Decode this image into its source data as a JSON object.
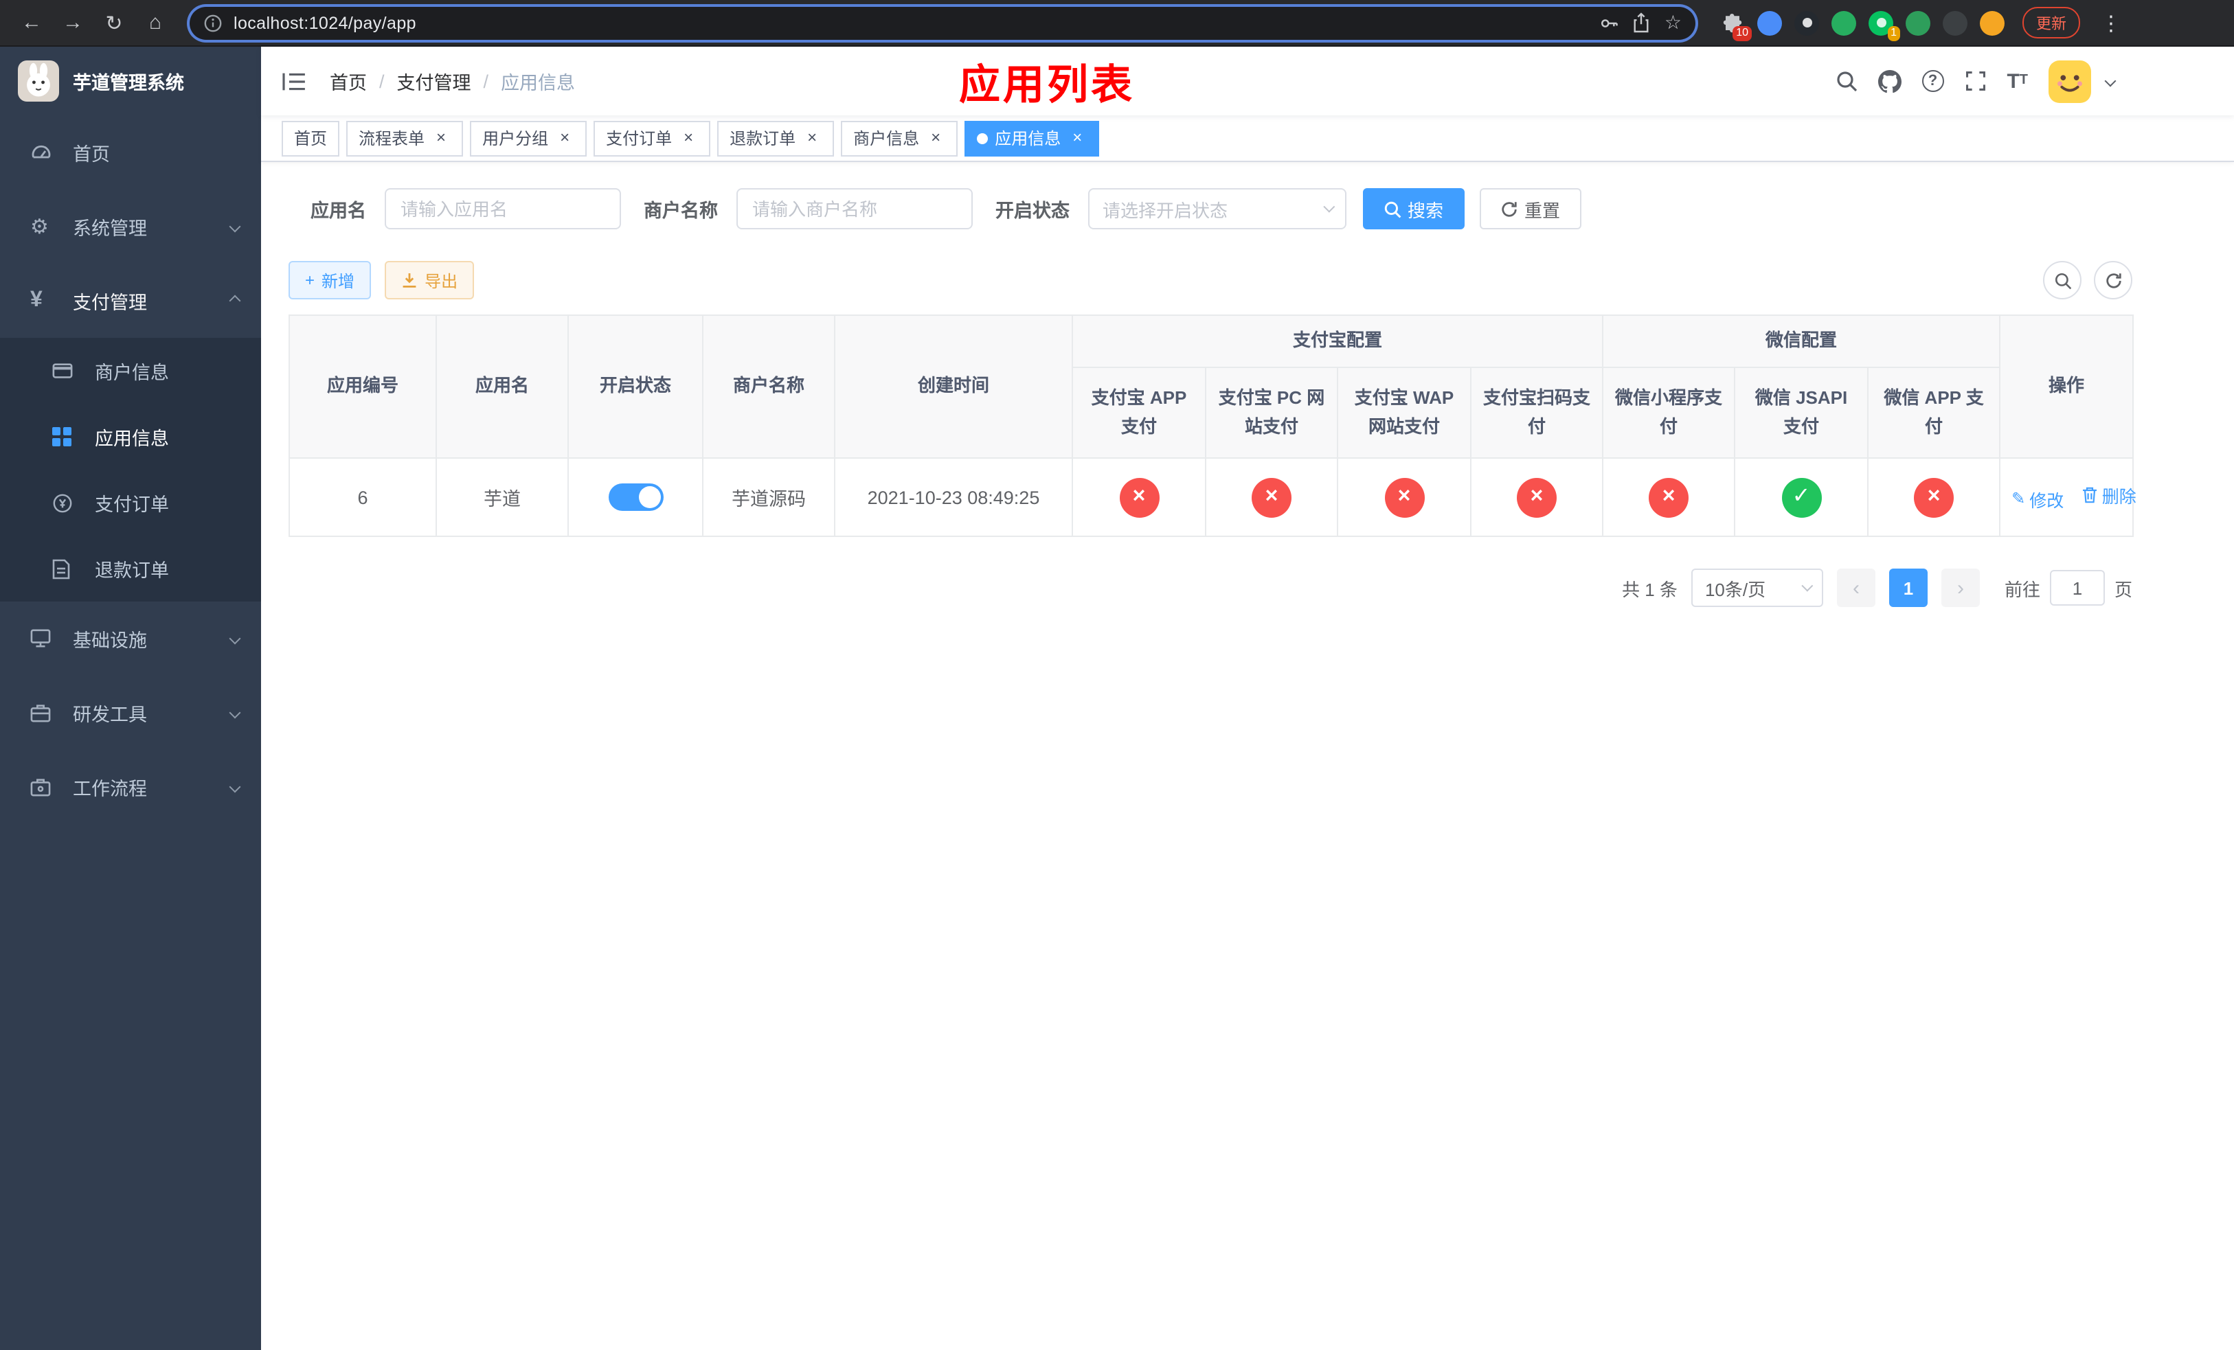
{
  "browser": {
    "url": "localhost:1024/pay/app",
    "update_label": "更新",
    "extensions_badge": "10",
    "extension_badge_2": "1"
  },
  "sidebar": {
    "title": "芋道管理系统",
    "menu": [
      {
        "label": "首页"
      },
      {
        "label": "系统管理",
        "expandable": true
      },
      {
        "label": "支付管理",
        "expandable": true,
        "expanded": true
      },
      {
        "label": "商户信息",
        "submenu": true
      },
      {
        "label": "应用信息",
        "submenu": true,
        "active": true
      },
      {
        "label": "支付订单",
        "submenu": true
      },
      {
        "label": "退款订单",
        "submenu": true
      },
      {
        "label": "基础设施",
        "expandable": true
      },
      {
        "label": "研发工具",
        "expandable": true
      },
      {
        "label": "工作流程",
        "expandable": true
      }
    ]
  },
  "header": {
    "breadcrumb": [
      "首页",
      "支付管理",
      "应用信息"
    ],
    "title": "应用列表"
  },
  "tabs": [
    {
      "label": "首页",
      "closable": false,
      "active": false
    },
    {
      "label": "流程表单",
      "closable": true,
      "active": false
    },
    {
      "label": "用户分组",
      "closable": true,
      "active": false
    },
    {
      "label": "支付订单",
      "closable": true,
      "active": false
    },
    {
      "label": "退款订单",
      "closable": true,
      "active": false
    },
    {
      "label": "商户信息",
      "closable": true,
      "active": false
    },
    {
      "label": "应用信息",
      "closable": true,
      "active": true
    }
  ],
  "filters": {
    "app_name_label": "应用名",
    "app_name_placeholder": "请输入应用名",
    "merchant_label": "商户名称",
    "merchant_placeholder": "请输入商户名称",
    "status_label": "开启状态",
    "status_placeholder": "请选择开启状态",
    "search_label": "搜索",
    "reset_label": "重置"
  },
  "toolbar": {
    "add_label": "新增",
    "export_label": "导出"
  },
  "table": {
    "headers": {
      "app_id": "应用编号",
      "app_name": "应用名",
      "status": "开启状态",
      "merchant": "商户名称",
      "created": "创建时间",
      "alipay_group": "支付宝配置",
      "alipay_app": "支付宝 APP 支付",
      "alipay_pc": "支付宝 PC 网站支付",
      "alipay_wap": "支付宝 WAP 网站支付",
      "alipay_qr": "支付宝扫码支付",
      "wechat_group": "微信配置",
      "wx_lite": "微信小程序支付",
      "wx_jsapi": "微信 JSAPI 支付",
      "wx_app": "微信 APP 支付",
      "actions": "操作"
    },
    "row": {
      "id": "6",
      "name": "芋道",
      "enabled": true,
      "merchant": "芋道源码",
      "created": "2021-10-23 08:49:25",
      "channels": [
        false,
        false,
        false,
        false,
        false,
        true,
        false
      ],
      "edit_label": "修改",
      "delete_label": "删除"
    }
  },
  "pagination": {
    "total": "共 1 条",
    "page_size": "10条/页",
    "page": "1",
    "goto_label": "前往",
    "goto_value": "1",
    "goto_suffix": "页"
  },
  "colors": {
    "accent": "#409eff",
    "success": "#21c45d",
    "danger": "#f8514d",
    "warning": "#e6a23c",
    "title": "#ff0000"
  }
}
